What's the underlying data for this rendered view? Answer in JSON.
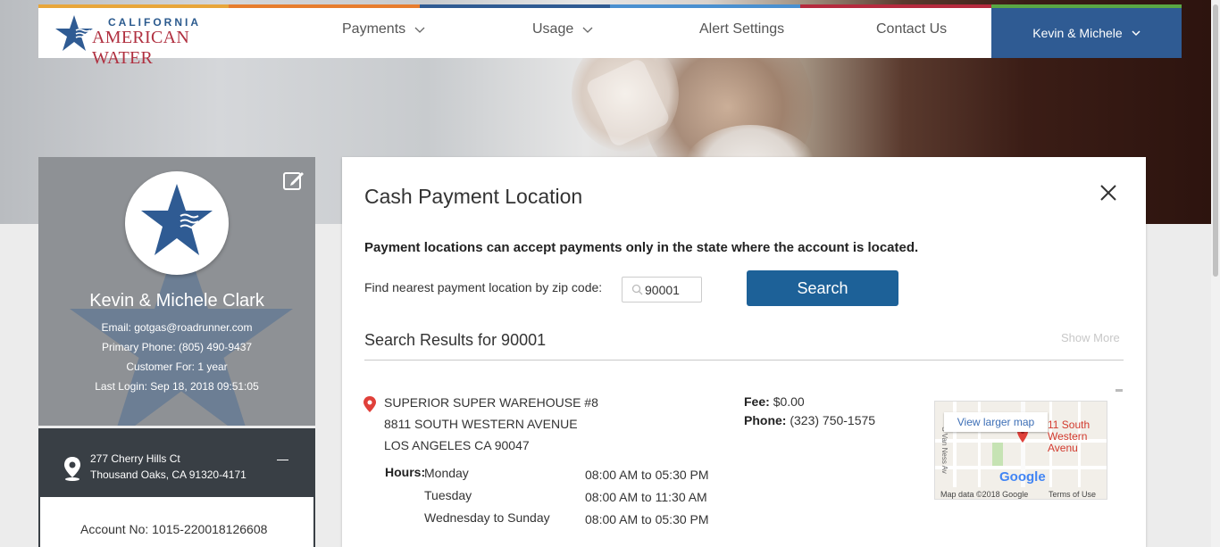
{
  "brand": {
    "line1": "CALIFORNIA",
    "line2": "AMERICAN WATER",
    "colors": [
      "#e8a63a",
      "#e77d2e",
      "#2f5b93",
      "#4a90d0",
      "#b52a3e",
      "#5aa744"
    ]
  },
  "nav": {
    "items": [
      {
        "label": "Payments",
        "dropdown": true
      },
      {
        "label": "Usage",
        "dropdown": true
      },
      {
        "label": "Alert Settings",
        "dropdown": false
      },
      {
        "label": "Contact Us",
        "dropdown": false
      }
    ],
    "user": "Kevin & Michele"
  },
  "profile": {
    "name": "Kevin & Michele Clark",
    "email": "Email: gotgas@roadrunner.com",
    "phone": "Primary Phone: (805) 490-9437",
    "customer_for": "Customer For: 1 year",
    "last_login": "Last Login: Sep 18, 2018 09:51:05",
    "address_line1": "277 Cherry Hills Ct",
    "address_line2": "Thousand Oaks, CA 91320-4171",
    "account": "Account No: 1015-220018126608"
  },
  "modal": {
    "title": "Cash Payment Location",
    "notice": "Payment locations can accept payments only in the state where the account is located.",
    "zip_label": "Find nearest payment location by zip code:",
    "zip_value": "90001",
    "search_label": "Search",
    "results_title": "Search Results for 90001",
    "show_more": "Show More",
    "result": {
      "name": "SUPERIOR SUPER WAREHOUSE #8",
      "street": "8811 SOUTH WESTERN AVENUE",
      "city": "LOS ANGELES CA 90047",
      "fee_label": "Fee:",
      "fee": "$0.00",
      "phone_label": "Phone:",
      "phone": "(323) 750-1575",
      "hours_label": "Hours:",
      "hours": [
        {
          "day": "Monday",
          "time": "08:00 AM to 05:30 PM"
        },
        {
          "day": "Tuesday",
          "time": "08:00 AM to 11:30 AM"
        },
        {
          "day": "Wednesday to Sunday",
          "time": "08:00 AM to 05:30 PM"
        }
      ],
      "map": {
        "view_larger": "View larger map",
        "place_line1": "11 South",
        "place_line2": "Western Avenu",
        "google": "Google",
        "map_data": "Map data ©2018 Google",
        "terms": "Terms of Use",
        "street_side": "S Van Ness Av"
      }
    }
  }
}
